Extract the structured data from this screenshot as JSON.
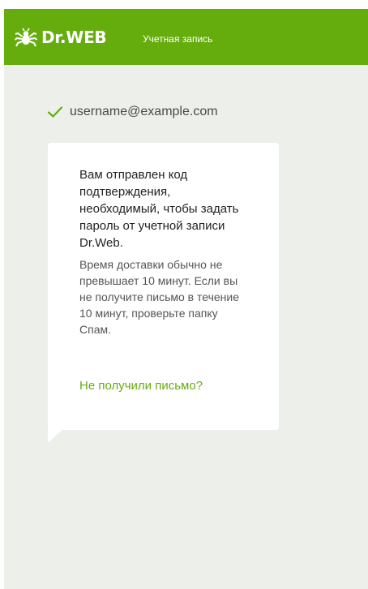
{
  "header": {
    "brand": "Dr.WEB",
    "title": "Учетная запись",
    "logo_icon": "spider-logo-icon"
  },
  "account": {
    "email": "username@example.com",
    "status_icon": "check-icon"
  },
  "message": {
    "main": "Вам отправлен код подтверждения, необходимый, чтобы задать пароль от учетной записи Dr.Web.",
    "sub": "Время доставки обычно не превышает 10 минут. Если вы не получите письмо в течение 10 минут, проверьте папку Спам.",
    "resend_link": "Не получили письмо?"
  },
  "colors": {
    "brand_green": "#65ad0d",
    "background": "#edefea",
    "card": "#ffffff"
  }
}
